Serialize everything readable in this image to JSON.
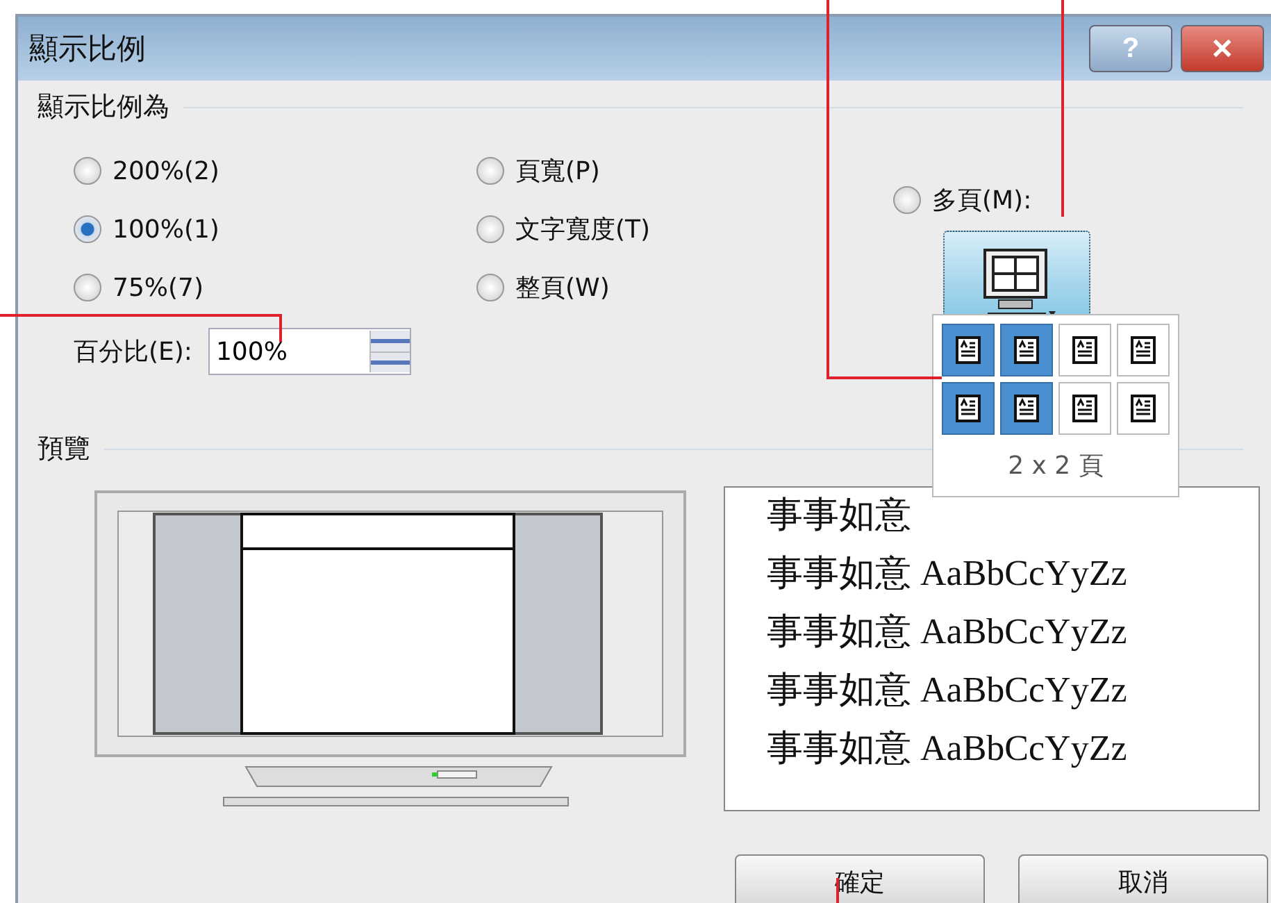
{
  "window": {
    "title": "顯示比例",
    "help": "?",
    "close": "✕"
  },
  "zoom_to": {
    "heading": "顯示比例為",
    "options": [
      {
        "label": "200%(2)",
        "selected": false
      },
      {
        "label": "頁寬(P)",
        "selected": false
      },
      {
        "label": "多頁(M):",
        "selected": false
      },
      {
        "label": "100%(1)",
        "selected": true
      },
      {
        "label": "文字寬度(T)",
        "selected": false
      },
      {
        "label": "75%(7)",
        "selected": false
      },
      {
        "label": "整頁(W)",
        "selected": false
      }
    ],
    "percent": {
      "label": "百分比(E):",
      "value": "100%"
    }
  },
  "pages_popup": {
    "cells": [
      {
        "selected": true
      },
      {
        "selected": true
      },
      {
        "selected": false
      },
      {
        "selected": false
      },
      {
        "selected": true
      },
      {
        "selected": true
      },
      {
        "selected": false
      },
      {
        "selected": false
      }
    ],
    "caption": "2 x 2 頁"
  },
  "preview": {
    "heading": "預覽",
    "sample_lines": [
      "事事如意",
      "事事如意 AaBbCcYyZz",
      "事事如意 AaBbCcYyZz",
      "事事如意 AaBbCcYyZz",
      "事事如意 AaBbCcYyZz"
    ]
  },
  "buttons": [
    "確定",
    "取消"
  ]
}
